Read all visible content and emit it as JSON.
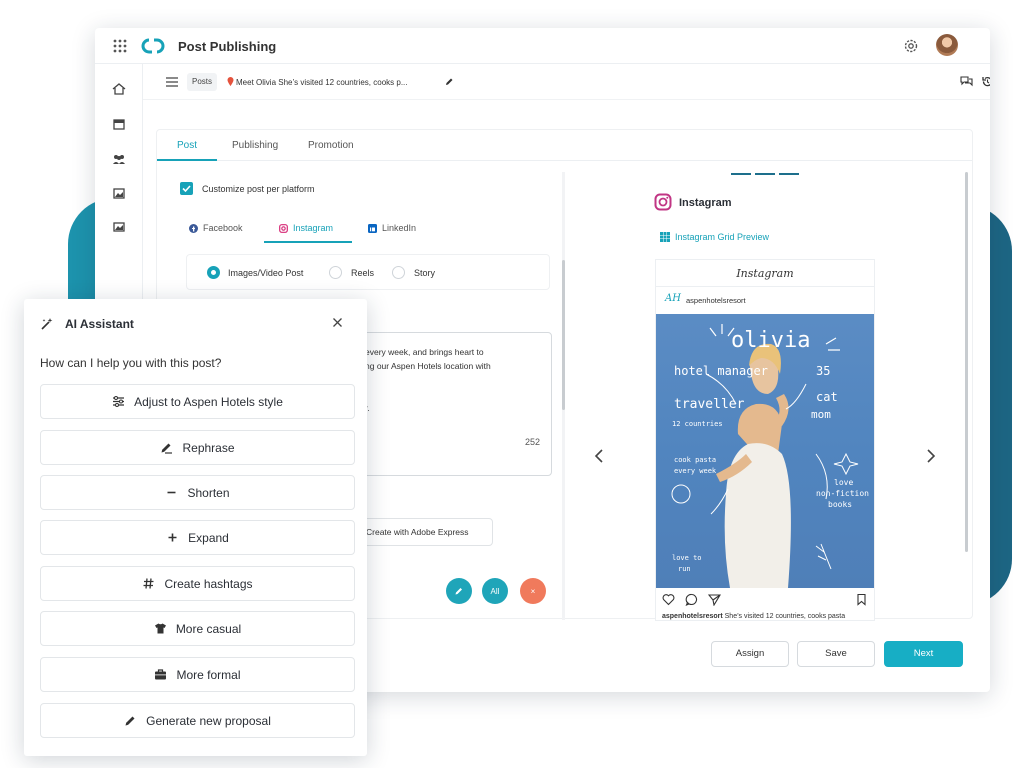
{
  "app": {
    "title": "Post Publishing"
  },
  "breadcrumb": {
    "section": "Posts",
    "current": "Meet Olivia She’s visited 12 countries, cooks p..."
  },
  "tabs": [
    "Post",
    "Publishing",
    "Promotion"
  ],
  "customize": {
    "label": "Customize post per platform",
    "checked": true
  },
  "platforms": [
    "Facebook",
    "Instagram",
    "LinkedIn"
  ],
  "post_types": [
    "Images/Video Post",
    "Reels",
    "Story"
  ],
  "caption": {
    "lines": [
      "every week, and brings heart to",
      "ng our Aspen Hotels location with",
      "",
      "r.",
      "!"
    ],
    "char_count": "252"
  },
  "adobe_button": "Create with Adobe Express",
  "fabs": {
    "all": "All",
    "close": "×"
  },
  "preview": {
    "platform": "Instagram",
    "grid_link": "Instagram Grid Preview",
    "ig_wordmark": "Instagram",
    "account_logo": "AH",
    "account": "aspenhotelsresort",
    "doodles": {
      "name": "olivia",
      "role": "hotel manager",
      "age": "35",
      "traveller": "traveller",
      "countries": "12 countries",
      "cat": "cat",
      "mom": "mom",
      "cook1": "cook pasta",
      "cook2": "every week",
      "love1": "love",
      "love2": "non-fiction",
      "love3": "books",
      "run1": "love to",
      "run2": "run"
    },
    "caption_user": "aspenhotelsresort",
    "caption_text": "She’s visited 12 countries, cooks pasta"
  },
  "actions": {
    "assign": "Assign",
    "save": "Save",
    "next": "Next"
  },
  "ai_assistant": {
    "title": "AI Assistant",
    "question": "How can I help you with this post?",
    "options": [
      "Adjust to Aspen Hotels style",
      "Rephrase",
      "Shorten",
      "Expand",
      "Create hashtags",
      "More casual",
      "More formal",
      "Generate new proposal"
    ]
  },
  "colors": {
    "accent": "#17a2b8",
    "next_button": "#17aec5",
    "close_fab": "#f07a5c",
    "blob_left": "#1d93ad",
    "blob_right": "#1d6684"
  }
}
